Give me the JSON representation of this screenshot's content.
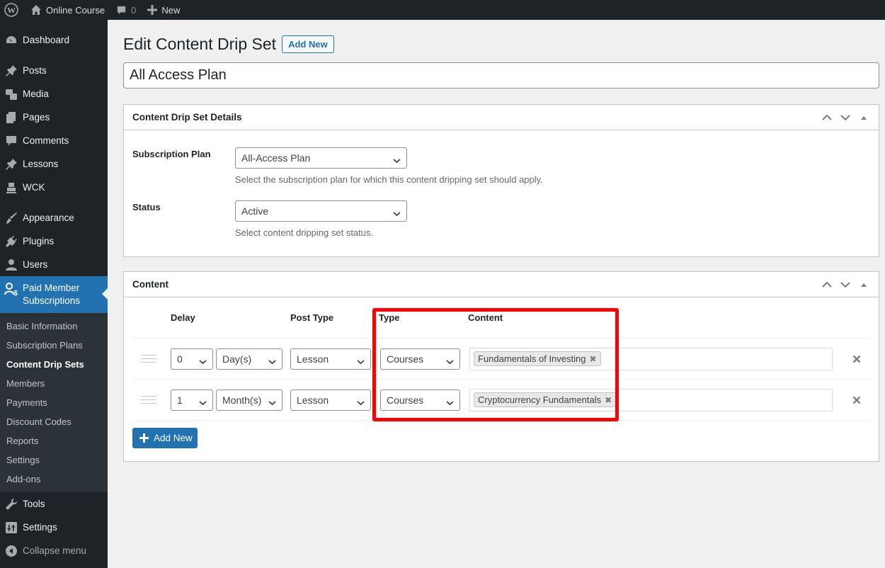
{
  "adminbar": {
    "site_name": "Online Course",
    "comments_count": "0",
    "new_label": "New"
  },
  "sidebar": {
    "items": [
      {
        "label": "Dashboard",
        "icon": "dashboard-icon"
      },
      {
        "label": "Posts",
        "icon": "pin-icon"
      },
      {
        "label": "Media",
        "icon": "media-icon"
      },
      {
        "label": "Pages",
        "icon": "pages-icon"
      },
      {
        "label": "Comments",
        "icon": "comment-icon"
      },
      {
        "label": "Lessons",
        "icon": "pin-icon"
      },
      {
        "label": "WCK",
        "icon": "wck-icon"
      },
      {
        "label": "Appearance",
        "icon": "brush-icon"
      },
      {
        "label": "Plugins",
        "icon": "plug-icon"
      },
      {
        "label": "Users",
        "icon": "user-icon"
      },
      {
        "label": "Paid Member Subscriptions",
        "label_line1": "Paid Member",
        "label_line2": "Subscriptions",
        "icon": "member-dollar-icon"
      },
      {
        "label": "Tools",
        "icon": "wrench-icon"
      },
      {
        "label": "Settings",
        "icon": "settings-icon"
      },
      {
        "label": "Collapse menu",
        "icon": "collapse-icon"
      }
    ],
    "submenu": [
      "Basic Information",
      "Subscription Plans",
      "Content Drip Sets",
      "Members",
      "Payments",
      "Discount Codes",
      "Reports",
      "Settings",
      "Add-ons"
    ],
    "active_submenu": "Content Drip Sets"
  },
  "page": {
    "title": "Edit Content Drip Set",
    "add_new_label": "Add New",
    "set_name": "All Access Plan"
  },
  "details_box": {
    "title": "Content Drip Set Details",
    "subscription_plan": {
      "label": "Subscription Plan",
      "value": "All-Access Plan",
      "description": "Select the subscription plan for which this content dripping set should apply."
    },
    "status": {
      "label": "Status",
      "value": "Active",
      "description": "Select content dripping set status."
    }
  },
  "content_box": {
    "title": "Content",
    "columns": [
      "Delay",
      "Post Type",
      "Type",
      "Content"
    ],
    "rows": [
      {
        "delay": "0",
        "unit": "Day(s)",
        "post_type": "Lesson",
        "type": "Courses",
        "content": "Fundamentals of Investing"
      },
      {
        "delay": "1",
        "unit": "Month(s)",
        "post_type": "Lesson",
        "type": "Courses",
        "content": "Cryptocurrency Fundamentals"
      }
    ],
    "add_new_label": "Add New"
  },
  "colors": {
    "accent": "#2271b1",
    "sidebar_bg": "#1d2327",
    "highlight": "#ff0000"
  }
}
